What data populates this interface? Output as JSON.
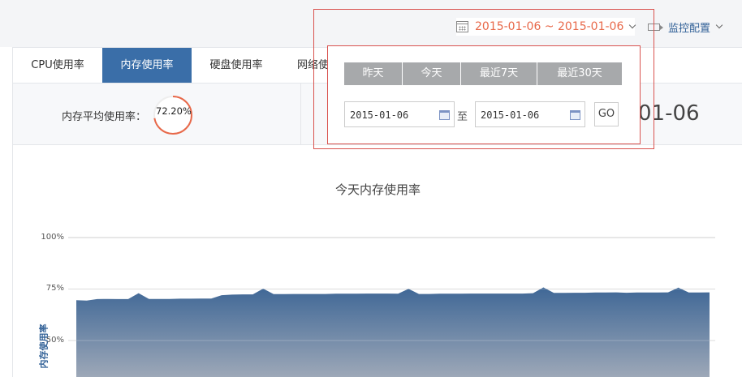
{
  "header": {
    "date_range": "2015-01-06 ~ 2015-01-06",
    "monitor_label": "监控配置"
  },
  "tabs": [
    {
      "label": "CPU使用率",
      "active": false
    },
    {
      "label": "内存使用率",
      "active": true
    },
    {
      "label": "硬盘使用率",
      "active": false
    },
    {
      "label": "网络使",
      "active": false
    }
  ],
  "stats": {
    "avg_label": "内存平均使用率：",
    "avg_value": "72.20%",
    "avg_fraction": 0.722,
    "date_display": "01-06"
  },
  "picker": {
    "quick": [
      "昨天",
      "今天",
      "最近7天",
      "最近30天"
    ],
    "start_value": "2015-01-06",
    "end_value": "2015-01-06",
    "to_label": "至",
    "go_label": "GO"
  },
  "colors": {
    "accent": "#e8694a",
    "tab_active": "#3a6ea8",
    "series_top": "#3f6796",
    "series_bottom": "#a9b0bc"
  },
  "chart_data": {
    "type": "area",
    "title": "今天内存使用率",
    "ylabel": "内存使用率",
    "yticks": [
      "100%",
      "75%",
      "50%"
    ],
    "ylim": [
      0,
      100
    ],
    "grid": true,
    "series": [
      {
        "values": [
          69.6,
          69.4,
          70.1,
          70.2,
          70.1,
          70.1,
          73.0,
          70.2,
          70.2,
          70.2,
          70.3,
          70.3,
          70.4,
          70.4,
          72.0,
          72.3,
          72.4,
          72.4,
          75.2,
          72.5,
          72.5,
          72.6,
          72.6,
          72.6,
          72.6,
          72.7,
          72.7,
          72.7,
          72.8,
          72.8,
          72.8,
          72.7,
          75.1,
          72.6,
          72.6,
          72.7,
          72.7,
          72.7,
          72.8,
          72.8,
          72.8,
          72.8,
          72.8,
          72.8,
          73.0,
          75.8,
          73.1,
          73.1,
          73.2,
          73.2,
          73.3,
          73.3,
          73.4,
          73.2,
          73.3,
          73.3,
          73.3,
          73.4,
          75.7,
          73.3,
          73.3,
          73.4
        ]
      }
    ]
  }
}
